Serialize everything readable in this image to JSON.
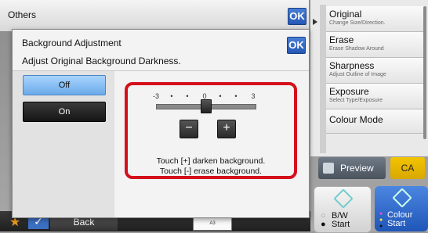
{
  "others": {
    "title": "Others",
    "ok_label": "OK"
  },
  "side_panel": {
    "items": [
      {
        "title": "Original",
        "subtitle": "Change Size/Direction."
      },
      {
        "title": "Erase",
        "subtitle": "Erase Shadow Around"
      },
      {
        "title": "Sharpness",
        "subtitle": "Adjust Outline of Image"
      },
      {
        "title": "Exposure",
        "subtitle": "Select Type/Exposure"
      },
      {
        "title": "Colour Mode",
        "subtitle": ""
      }
    ]
  },
  "actions": {
    "preview_label": "Preview",
    "ca_label": "CA"
  },
  "start": {
    "bw_line1": "B/W",
    "bw_line2": "Start",
    "colour_line1": "Colour",
    "colour_line2": "Start"
  },
  "bottom": {
    "back_label": "Back",
    "paper_label": "A3"
  },
  "dialog": {
    "title": "Background Adjustment",
    "ok_label": "OK",
    "subtitle": "Adjust Original Background Darkness.",
    "off_label": "Off",
    "on_label": "On",
    "selected": "Off",
    "slider": {
      "ticks": [
        "-3",
        "•",
        "•",
        "0",
        "•",
        "•",
        "3"
      ],
      "min": -3,
      "max": 3,
      "value": 0,
      "minus_label": "−",
      "plus_label": "+"
    },
    "hint_plus": "Touch [+] darken background.",
    "hint_minus": "Touch [-] erase background."
  },
  "colors": {
    "accent": "#2557b4",
    "highlight": "#d4101c",
    "selected": "#6aaae8",
    "ca": "#f2c400"
  },
  "icons": [
    "star-icon",
    "check-icon",
    "preview-icon",
    "bw-start-icon",
    "colour-start-icon",
    "panel-arrow-icon"
  ]
}
